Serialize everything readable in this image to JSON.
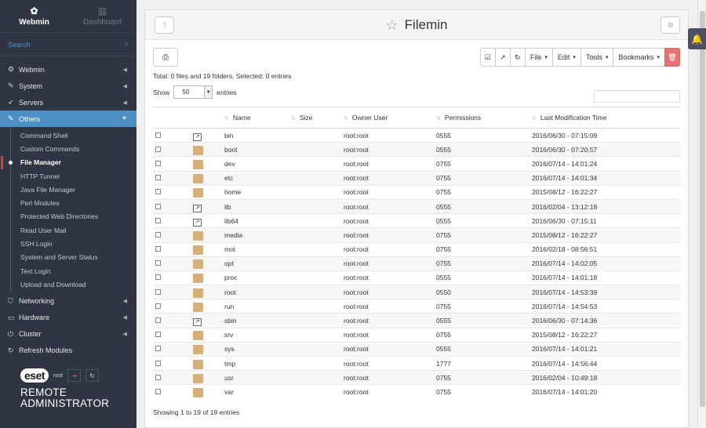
{
  "sidebar": {
    "tabs": [
      {
        "label": "Webmin",
        "icon": "webmin-logo-icon"
      },
      {
        "label": "Dashboard",
        "icon": "dashboard-chart-icon"
      }
    ],
    "search_placeholder": "Search",
    "nav": [
      {
        "label": "Webmin",
        "icon": "gear-icon"
      },
      {
        "label": "System",
        "icon": "wrench-icon"
      },
      {
        "label": "Servers",
        "icon": "rocket-icon"
      },
      {
        "label": "Others",
        "icon": "wrench-icon"
      },
      {
        "label": "Networking",
        "icon": "shield-icon"
      },
      {
        "label": "Hardware",
        "icon": "hdd-icon"
      },
      {
        "label": "Cluster",
        "icon": "power-icon"
      },
      {
        "label": "Refresh Modules",
        "icon": "refresh-icon"
      }
    ],
    "others_items": [
      "Command Shell",
      "Custom Commands",
      "File Manager",
      "HTTP Tunnel",
      "Java File Manager",
      "Perl Modules",
      "Protected Web Directories",
      "Read User Mail",
      "SSH Login",
      "System and Server Status",
      "Text Login",
      "Upload and Download"
    ],
    "brand": {
      "logo": "eset",
      "user": "root",
      "line1": "REMOTE",
      "line2": "ADMINISTRATOR"
    }
  },
  "header": {
    "title": "Filemin"
  },
  "toolbar": {
    "file": "File",
    "edit": "Edit",
    "tools": "Tools",
    "bookmarks": "Bookmarks"
  },
  "summary": "Total: 0 files and 19 folders. Selected: 0 entries",
  "show": {
    "label": "Show",
    "value": "50",
    "suffix": "entries"
  },
  "columns": [
    "Name",
    "Size",
    "Owner User",
    "Permissions",
    "Last Modification Time"
  ],
  "rows": [
    {
      "name": "bin",
      "type": "link",
      "size": "",
      "owner": "root:root",
      "perm": "0555",
      "time": "2016/06/30 - 07:15:09"
    },
    {
      "name": "boot",
      "type": "folder",
      "size": "",
      "owner": "root:root",
      "perm": "0555",
      "time": "2016/06/30 - 07:20:57"
    },
    {
      "name": "dev",
      "type": "folder",
      "size": "",
      "owner": "root:root",
      "perm": "0755",
      "time": "2016/07/14 - 14:01:24"
    },
    {
      "name": "etc",
      "type": "folder",
      "size": "",
      "owner": "root:root",
      "perm": "0755",
      "time": "2016/07/14 - 14:01:34"
    },
    {
      "name": "home",
      "type": "folder",
      "size": "",
      "owner": "root:root",
      "perm": "0755",
      "time": "2015/08/12 - 16:22:27"
    },
    {
      "name": "lib",
      "type": "link",
      "size": "",
      "owner": "root:root",
      "perm": "0555",
      "time": "2016/02/04 - 13:12:18"
    },
    {
      "name": "lib64",
      "type": "link",
      "size": "",
      "owner": "root:root",
      "perm": "0555",
      "time": "2016/06/30 - 07:15:11"
    },
    {
      "name": "media",
      "type": "folder",
      "size": "",
      "owner": "root:root",
      "perm": "0755",
      "time": "2015/08/12 - 16:22:27"
    },
    {
      "name": "mnt",
      "type": "folder",
      "size": "",
      "owner": "root:root",
      "perm": "0755",
      "time": "2016/02/18 - 08:56:51"
    },
    {
      "name": "opt",
      "type": "folder",
      "size": "",
      "owner": "root:root",
      "perm": "0755",
      "time": "2016/07/14 - 14:02:05"
    },
    {
      "name": "proc",
      "type": "folder",
      "size": "",
      "owner": "root:root",
      "perm": "0555",
      "time": "2016/07/14 - 14:01:18"
    },
    {
      "name": "root",
      "type": "folder",
      "size": "",
      "owner": "root:root",
      "perm": "0550",
      "time": "2016/07/14 - 14:53:39"
    },
    {
      "name": "run",
      "type": "folder",
      "size": "",
      "owner": "root:root",
      "perm": "0755",
      "time": "2016/07/14 - 14:54:53"
    },
    {
      "name": "sbin",
      "type": "link",
      "size": "",
      "owner": "root:root",
      "perm": "0555",
      "time": "2016/06/30 - 07:14:36"
    },
    {
      "name": "srv",
      "type": "folder",
      "size": "",
      "owner": "root:root",
      "perm": "0755",
      "time": "2015/08/12 - 16:22:27"
    },
    {
      "name": "sys",
      "type": "folder",
      "size": "",
      "owner": "root:root",
      "perm": "0555",
      "time": "2016/07/14 - 14:01:21"
    },
    {
      "name": "tmp",
      "type": "folder",
      "size": "",
      "owner": "root:root",
      "perm": "1777",
      "time": "2016/07/14 - 14:56:44"
    },
    {
      "name": "usr",
      "type": "folder",
      "size": "",
      "owner": "root:root",
      "perm": "0755",
      "time": "2016/02/04 - 10:49:18"
    },
    {
      "name": "var",
      "type": "folder",
      "size": "",
      "owner": "root:root",
      "perm": "0755",
      "time": "2016/07/14 - 14:01:20"
    }
  ],
  "footer": "Showing 1 to 19 of 19 entries",
  "colors": {
    "sidebar_bg": "#2f3542",
    "accent": "#4e90c5",
    "danger": "#e27474",
    "folder": "#d6b07a"
  }
}
